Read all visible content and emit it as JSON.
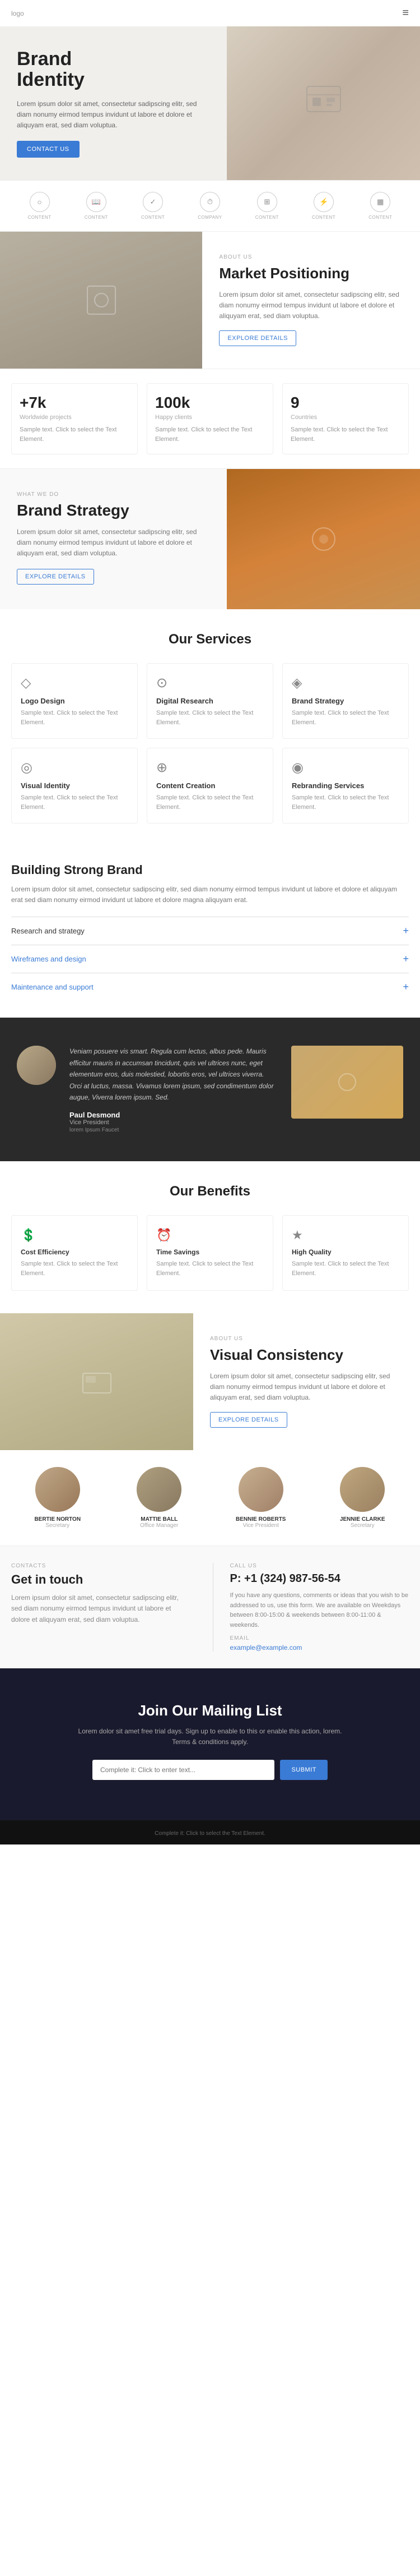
{
  "nav": {
    "logo": "logo",
    "menu_icon": "≡"
  },
  "hero": {
    "title": "Brand\nIdentity",
    "description": "Lorem ipsum dolor sit amet, consectetur sadipscing elitr, sed diam nonumy eirmod tempus invidunt ut labore et dolore et aliquyam erat, sed diam voluptua.",
    "button_label": "CONTACT US"
  },
  "icons_row": {
    "items": [
      {
        "label": "CONTENT",
        "icon": "circle"
      },
      {
        "label": "CONTENT",
        "icon": "book"
      },
      {
        "label": "CONTENT",
        "icon": "check"
      },
      {
        "label": "COMPANY",
        "icon": "clock"
      },
      {
        "label": "CONTENT",
        "icon": "grid"
      },
      {
        "label": "CONTENT",
        "icon": "bolt"
      },
      {
        "label": "CONTENT",
        "icon": "layout"
      }
    ]
  },
  "market": {
    "label": "ABOUT US",
    "title": "Market Positioning",
    "description": "Lorem ipsum dolor sit amet, consectetur sadipscing elitr, sed diam nonumy eirmod tempus invidunt ut labore et dolore et aliquyam erat, sed diam voluptua.",
    "button_label": "EXPLORE DETAILS"
  },
  "stats": [
    {
      "value": "+7k",
      "label": "Worldwide projects",
      "description": "Sample text. Click to select the Text Element."
    },
    {
      "value": "100k",
      "label": "Happy clients",
      "description": "Sample text. Click to select the Text Element."
    },
    {
      "value": "9",
      "label": "Countries",
      "description": "Sample text. Click to select the Text Element."
    }
  ],
  "strategy": {
    "label": "WHAT WE DO",
    "title": "Brand Strategy",
    "description": "Lorem ipsum dolor sit amet, consectetur sadipscing elitr, sed diam nonumy eirmod tempus invidunt ut labore et dolore et aliquyam erat, sed diam voluptua.",
    "button_label": "EXPLORE DETAILS"
  },
  "services": {
    "title": "Our Services",
    "items": [
      {
        "name": "Logo Design",
        "description": "Sample text. Click to select the Text Element."
      },
      {
        "name": "Digital Research",
        "description": "Sample text. Click to select the Text Element."
      },
      {
        "name": "Brand Strategy",
        "description": "Sample text. Click to select the Text Element."
      },
      {
        "name": "Visual Identity",
        "description": "Sample text. Click to select the Text Element."
      },
      {
        "name": "Content Creation",
        "description": "Sample text. Click to select the Text Element."
      },
      {
        "name": "Rebranding Services",
        "description": "Sample text. Click to select the Text Element."
      }
    ]
  },
  "building": {
    "title": "Building Strong Brand",
    "description": "Lorem ipsum dolor sit amet, consectetur sadipscing elitr, sed diam nonumy eirmod tempus invidunt ut labore et dolore et aliquyam erat sed diam nonumy eirmod invidunt ut labore et dolore magna aliquyam erat.",
    "accordion": [
      {
        "label": "Research and strategy",
        "expanded": true
      },
      {
        "label": "Wireframes and design",
        "expanded": false
      },
      {
        "label": "Maintenance and support",
        "expanded": false
      }
    ]
  },
  "testimonial": {
    "text": "Veniam posuere vis smart. Regula cum lectus, albus pede. Mauris efficitur mauris in accumsan tincidunt, quis vel ultrices nunc, eget elementum eros, duis molestied, lobortis eros, vel ultrices viverra. Orci at luctus, massa. Vivamus lorem ipsum, sed condimentum dolor augue, Viverra lorem ipsum. Sed.",
    "name": "Paul Desmond",
    "role": "Vice President",
    "company": "lorem Ipsum Faucet"
  },
  "benefits": {
    "title": "Our Benefits",
    "items": [
      {
        "name": "Cost Efficiency",
        "description": "Sample text. Click to select the Text Element."
      },
      {
        "name": "Time Savings",
        "description": "Sample text. Click to select the Text Element."
      },
      {
        "name": "High Quality",
        "description": "Sample text. Click to select the Text Element."
      }
    ]
  },
  "visual": {
    "label": "ABOUT US",
    "title": "Visual Consistency",
    "description": "Lorem ipsum dolor sit amet, consectetur sadipscing elitr, sed diam nonumy eirmod tempus invidunt ut labore et dolore et aliquyam erat, sed diam voluptua.",
    "button_label": "EXPLORE DETAILS"
  },
  "team": {
    "items": [
      {
        "name": "BERTIE NORTON",
        "role": "Secretary",
        "color": "#c8a888"
      },
      {
        "name": "MATTIE BALL",
        "role": "Office Manager",
        "color": "#a89878"
      },
      {
        "name": "BENNIE ROBERTS",
        "role": "Vice President",
        "color": "#c8b898"
      },
      {
        "name": "JENNIE CLARKE",
        "role": "Secretary",
        "color": "#b89880"
      }
    ]
  },
  "contact": {
    "get_in_touch": {
      "label": "CONTACTS",
      "title": "Get in touch",
      "description": "Lorem ipsum dolor sit amet, consectetur sadipscing elitr, sed diam nonumy eirmod tempus invidunt ut labore et dolore et aliquyam erat, sed diam voluptua."
    },
    "call_us": {
      "label": "CALL US",
      "phone": "P: +1 (324) 987-56-54",
      "description": "If you have any questions, comments or ideas that you wish to be addressed to us, use this form. We are available on Weekdays between 8:00-15:00 & weekends between 8:00-11:00 & weekends.",
      "email_label": "EMAIL",
      "email": "example@example.com"
    }
  },
  "mailing": {
    "title": "Join Our Mailing List",
    "description": "Lorem dolor sit amet free trial days. Sign up to enable to this or enable this action, lorem. Terms & conditions apply.",
    "input_placeholder": "Complete it: Click to enter text...",
    "button_label": "SUBMIT"
  },
  "footer": {
    "text": "Complete it: Click to select the Text Element."
  }
}
